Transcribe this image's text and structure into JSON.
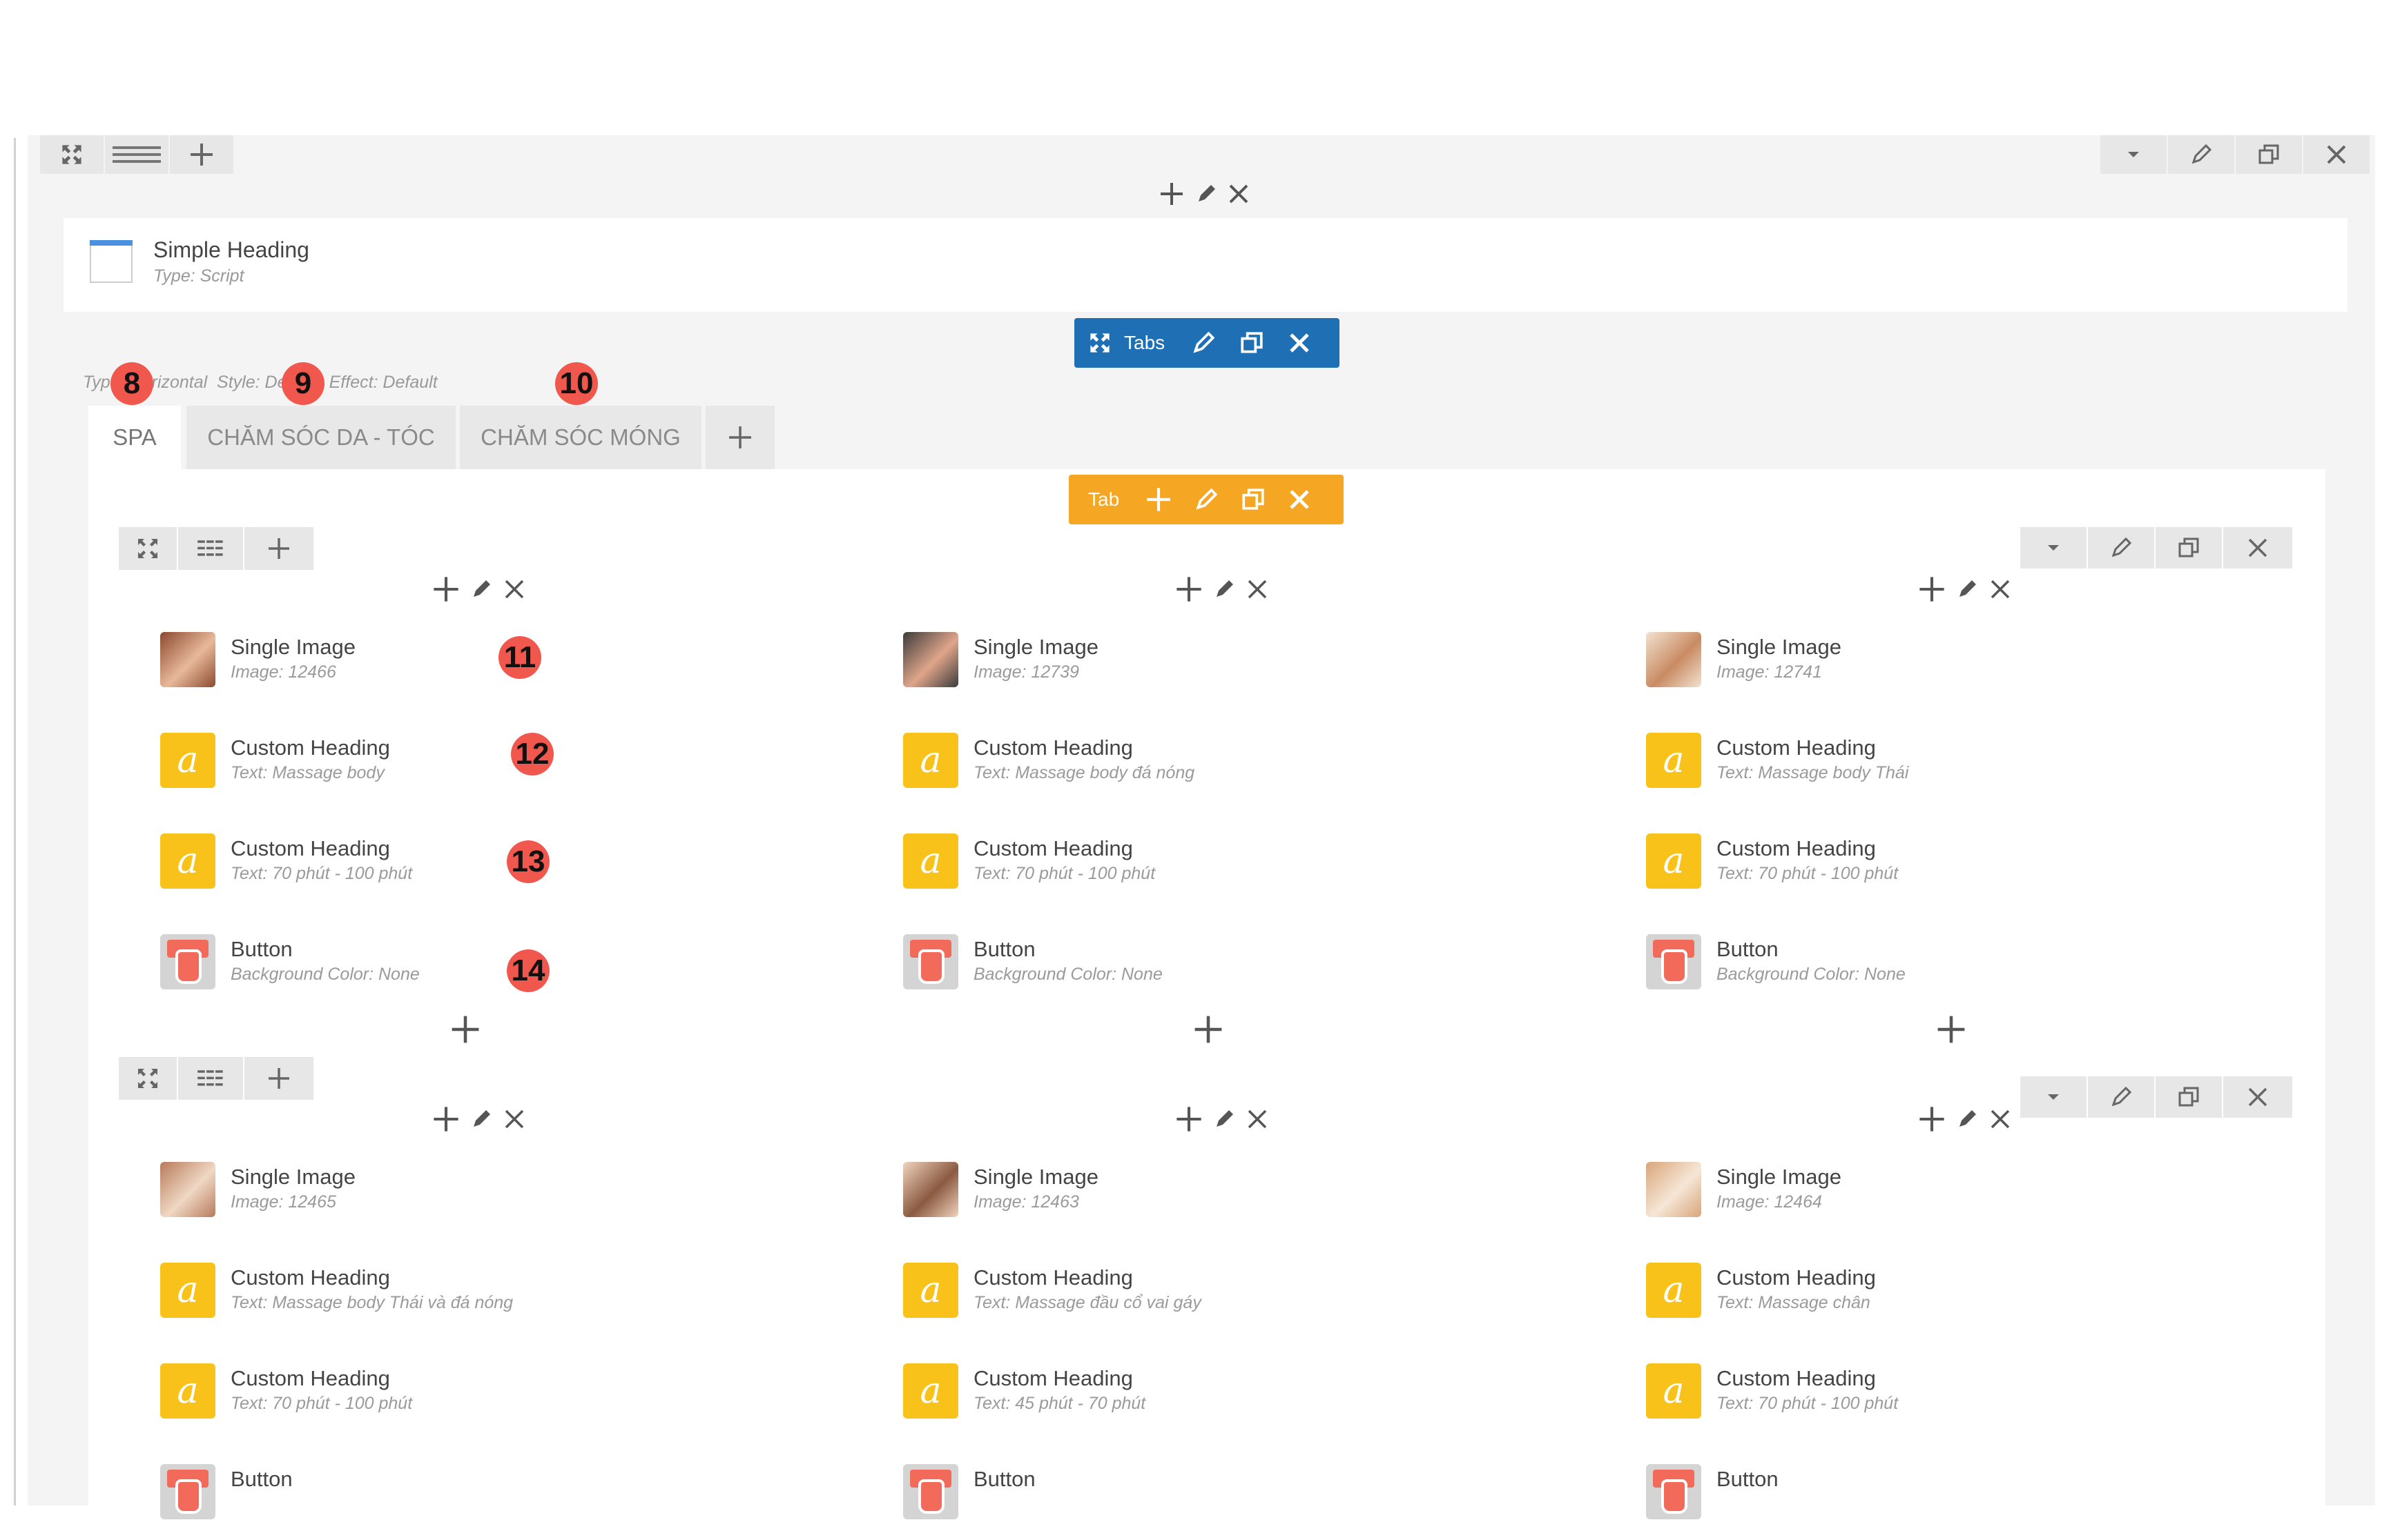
{
  "outer_row": {
    "expand_icon": "expand-icon",
    "layout_icon": "layout-icon",
    "add_icon": "plus-icon",
    "right_controls": [
      "caret-down-icon",
      "pencil-icon",
      "clone-icon",
      "close-icon"
    ]
  },
  "simple_heading": {
    "title": "Simple Heading",
    "type": "Type: Script"
  },
  "tabs_element": {
    "label": "Tabs",
    "meta": "Type: Horizontal  Style: Default  Effect: Default",
    "tabs": [
      "SPA",
      "CHĂM SÓC DA - TÓC",
      "CHĂM SÓC MÓNG"
    ],
    "active_tab": "SPA"
  },
  "tab_toolbar": {
    "label": "Tab"
  },
  "badges": [
    "8",
    "9",
    "10",
    "11",
    "12",
    "13",
    "14"
  ],
  "rows": [
    {
      "columns": [
        {
          "elements": [
            {
              "title": "Single Image",
              "sub": "Image: 12466",
              "kind": "image"
            },
            {
              "title": "Custom Heading",
              "sub": "Text: Massage body",
              "kind": "heading"
            },
            {
              "title": "Custom Heading",
              "sub": "Text: 70 phút - 100 phút",
              "kind": "heading"
            },
            {
              "title": "Button",
              "sub": "Background Color: None",
              "kind": "button"
            }
          ]
        },
        {
          "elements": [
            {
              "title": "Single Image",
              "sub": "Image: 12739",
              "kind": "image"
            },
            {
              "title": "Custom Heading",
              "sub": "Text: Massage body đá nóng",
              "kind": "heading"
            },
            {
              "title": "Custom Heading",
              "sub": "Text: 70 phút - 100 phút",
              "kind": "heading"
            },
            {
              "title": "Button",
              "sub": "Background Color: None",
              "kind": "button"
            }
          ]
        },
        {
          "elements": [
            {
              "title": "Single Image",
              "sub": "Image: 12741",
              "kind": "image"
            },
            {
              "title": "Custom Heading",
              "sub": "Text: Massage body Thái",
              "kind": "heading"
            },
            {
              "title": "Custom Heading",
              "sub": "Text: 70 phút - 100 phút",
              "kind": "heading"
            },
            {
              "title": "Button",
              "sub": "Background Color: None",
              "kind": "button"
            }
          ]
        }
      ]
    },
    {
      "columns": [
        {
          "elements": [
            {
              "title": "Single Image",
              "sub": "Image: 12465",
              "kind": "image"
            },
            {
              "title": "Custom Heading",
              "sub": "Text: Massage body Thái và đá nóng",
              "kind": "heading"
            },
            {
              "title": "Custom Heading",
              "sub": "Text: 70 phút - 100 phút",
              "kind": "heading"
            },
            {
              "title": "Button",
              "sub": "",
              "kind": "button"
            }
          ]
        },
        {
          "elements": [
            {
              "title": "Single Image",
              "sub": "Image: 12463",
              "kind": "image"
            },
            {
              "title": "Custom Heading",
              "sub": "Text: Massage đầu cổ vai gáy",
              "kind": "heading"
            },
            {
              "title": "Custom Heading",
              "sub": "Text: 45 phút - 70 phút",
              "kind": "heading"
            },
            {
              "title": "Button",
              "sub": "",
              "kind": "button"
            }
          ]
        },
        {
          "elements": [
            {
              "title": "Single Image",
              "sub": "Image: 12464",
              "kind": "image"
            },
            {
              "title": "Custom Heading",
              "sub": "Text: Massage chân",
              "kind": "heading"
            },
            {
              "title": "Custom Heading",
              "sub": "Text: 70 phút - 100 phút",
              "kind": "heading"
            },
            {
              "title": "Button",
              "sub": "",
              "kind": "button"
            }
          ]
        }
      ]
    }
  ],
  "colors": {
    "tabs_toolbar": "#1f6fb5",
    "tab_toolbar": "#f5a623",
    "badge": "#f0574d",
    "heading_icon": "#f9c21b",
    "button_icon": "#f26a5a"
  }
}
